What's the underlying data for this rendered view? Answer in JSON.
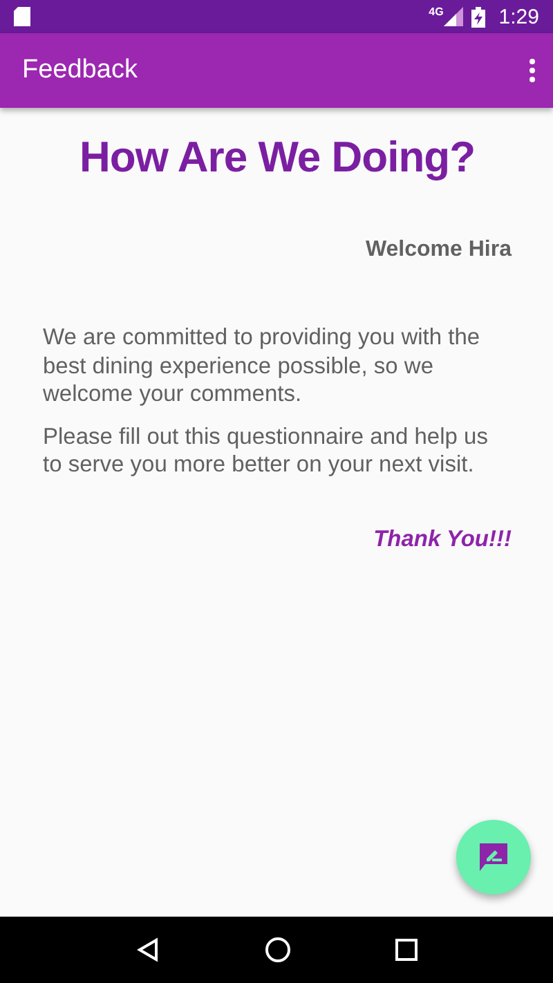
{
  "status_bar": {
    "network": "4G",
    "time": "1:29"
  },
  "toolbar": {
    "title": "Feedback"
  },
  "heading": "How Are We Doing?",
  "greeting": "Welcome Hira",
  "paragraphs": [
    "We are committed to providing you with the best dining experience possible, so we welcome your comments.",
    "Please fill out this questionnaire and help us to serve you more better on your next visit."
  ],
  "closing": "Thank You!!!"
}
